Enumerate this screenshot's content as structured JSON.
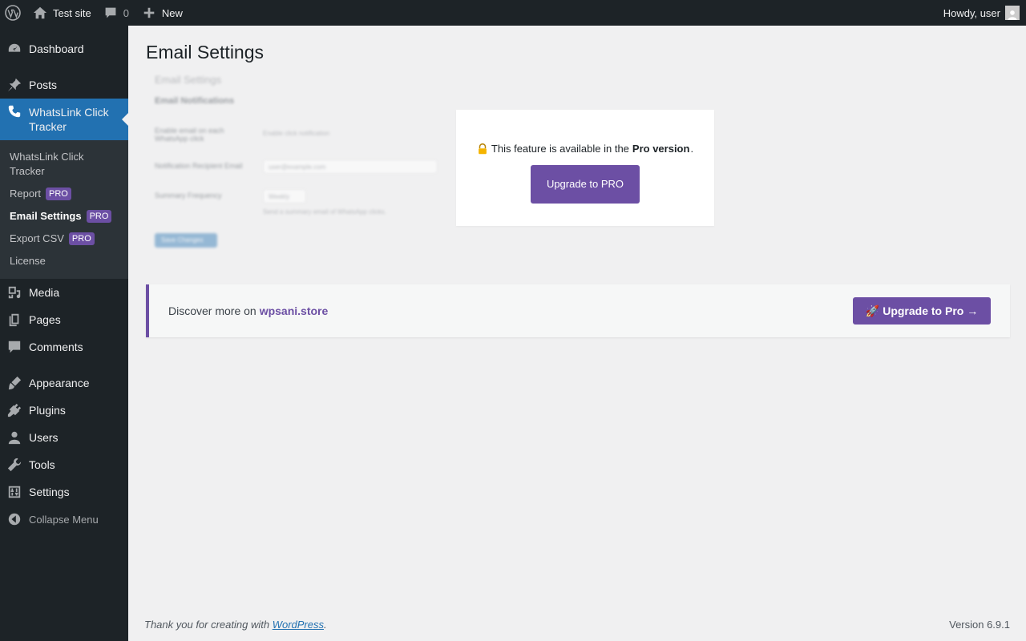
{
  "adminbar": {
    "site_name": "Test site",
    "comments_count": "0",
    "new_label": "New",
    "howdy": "Howdy, user"
  },
  "sidebar": {
    "items": [
      {
        "label": "Dashboard",
        "icon": "dashboard-icon"
      },
      {
        "label": "Posts",
        "icon": "pin-icon"
      },
      {
        "label": "WhatsLink Click Tracker",
        "icon": "phone-icon"
      },
      {
        "label": "Media",
        "icon": "media-icon"
      },
      {
        "label": "Pages",
        "icon": "pages-icon"
      },
      {
        "label": "Comments",
        "icon": "comments-icon"
      },
      {
        "label": "Appearance",
        "icon": "brush-icon"
      },
      {
        "label": "Plugins",
        "icon": "plugin-icon"
      },
      {
        "label": "Users",
        "icon": "users-icon"
      },
      {
        "label": "Tools",
        "icon": "wrench-icon"
      },
      {
        "label": "Settings",
        "icon": "settings-icon"
      }
    ],
    "submenu": [
      {
        "label": "WhatsLink Click Tracker"
      },
      {
        "label": "Report",
        "badge": "PRO"
      },
      {
        "label": "Email Settings",
        "badge": "PRO"
      },
      {
        "label": "Export CSV",
        "badge": "PRO"
      },
      {
        "label": "License"
      }
    ],
    "collapse_label": "Collapse Menu"
  },
  "page": {
    "title": "Email Settings"
  },
  "blurred_form": {
    "heading": "Email Settings",
    "section": "Email Notifications",
    "row1_label": "Enable email on each WhatsApp click",
    "row1_value": "Enable click notification",
    "row2_label": "Notification Recipient Email",
    "row2_value": "user@example.com",
    "row3_label": "Summary Frequency",
    "row3_value": "Weekly",
    "row3_desc": "Send a summary email of WhatsApp clicks.",
    "save_label": "Save Changes"
  },
  "pro_overlay": {
    "msg_before": "This feature is available in the",
    "msg_bold": "Pro version",
    "msg_after": ".",
    "button": "Upgrade to PRO"
  },
  "promo": {
    "text": "Discover more on",
    "link": "wpsani.store",
    "button": "Upgrade to Pro →",
    "rocket": "🚀"
  },
  "footer": {
    "thanks_before": "Thank you for creating with",
    "thanks_link": "WordPress",
    "thanks_after": ".",
    "version": "Version 6.9.1"
  },
  "colors": {
    "admin_dark": "#1d2327",
    "accent_blue": "#2271b1",
    "pro_purple": "#6c4fa4"
  }
}
